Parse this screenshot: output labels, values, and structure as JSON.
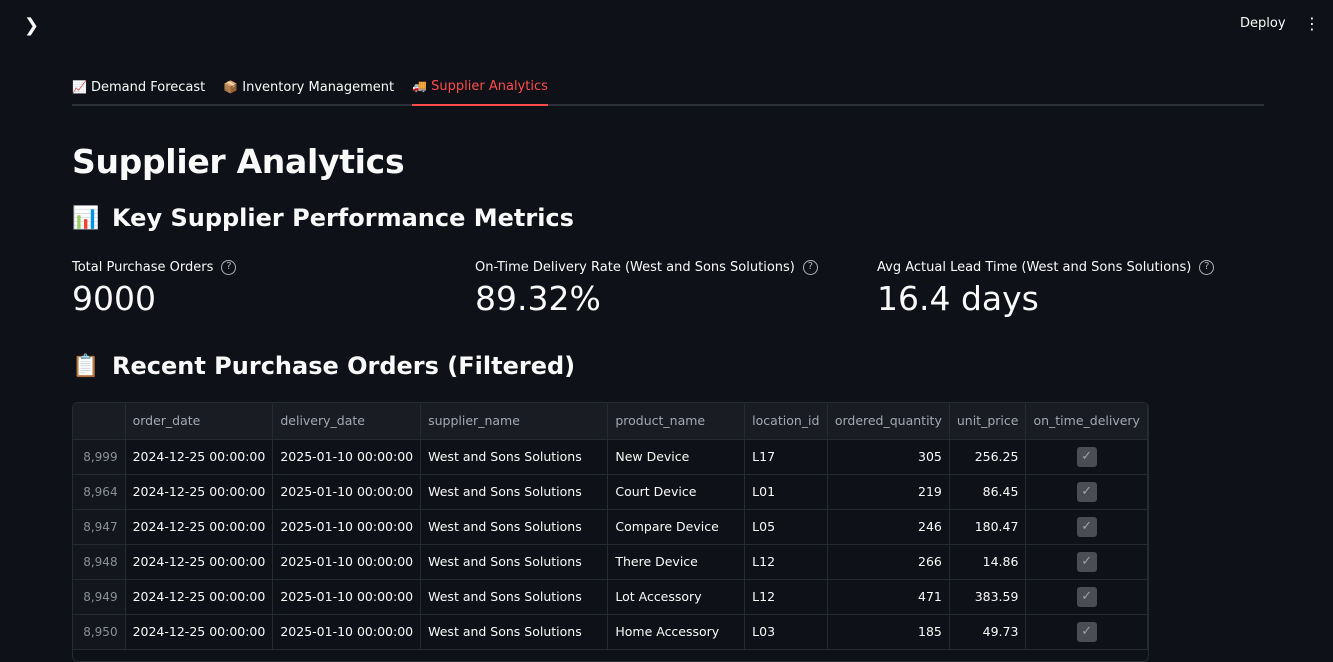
{
  "topbar": {
    "sidebar_toggle_icon": "chevron-right-icon",
    "deploy_label": "Deploy",
    "menu_icon": "vertical-dots-icon"
  },
  "tabs": [
    {
      "icon": "chart-increasing-emoji",
      "label": "Demand Forecast",
      "active": false
    },
    {
      "icon": "package-emoji",
      "label": "Inventory Management",
      "active": false
    },
    {
      "icon": "delivery-truck-emoji",
      "label": "Supplier Analytics",
      "active": true
    }
  ],
  "page_title": "Supplier Analytics",
  "metrics_section": {
    "icon": "bar-chart-emoji",
    "title": "Key Supplier Performance Metrics"
  },
  "metrics": [
    {
      "label": "Total Purchase Orders",
      "value": "9000"
    },
    {
      "label": "On-Time Delivery Rate (West and Sons Solutions)",
      "value": "89.32%"
    },
    {
      "label": "Avg Actual Lead Time (West and Sons Solutions)",
      "value": "16.4 days"
    }
  ],
  "orders_section": {
    "icon": "clipboard-emoji",
    "title": "Recent Purchase Orders (Filtered)"
  },
  "table": {
    "columns": [
      "",
      "order_date",
      "delivery_date",
      "supplier_name",
      "product_name",
      "location_id",
      "ordered_quantity",
      "unit_price",
      "on_time_delivery"
    ],
    "rows": [
      [
        "8,999",
        "2024-12-25 00:00:00",
        "2025-01-10 00:00:00",
        "West and Sons Solutions",
        "New Device",
        "L17",
        "305",
        "256.25",
        true
      ],
      [
        "8,964",
        "2024-12-25 00:00:00",
        "2025-01-10 00:00:00",
        "West and Sons Solutions",
        "Court Device",
        "L01",
        "219",
        "86.45",
        true
      ],
      [
        "8,947",
        "2024-12-25 00:00:00",
        "2025-01-10 00:00:00",
        "West and Sons Solutions",
        "Compare Device",
        "L05",
        "246",
        "180.47",
        true
      ],
      [
        "8,948",
        "2024-12-25 00:00:00",
        "2025-01-10 00:00:00",
        "West and Sons Solutions",
        "There Device",
        "L12",
        "266",
        "14.86",
        true
      ],
      [
        "8,949",
        "2024-12-25 00:00:00",
        "2025-01-10 00:00:00",
        "West and Sons Solutions",
        "Lot Accessory",
        "L12",
        "471",
        "383.59",
        true
      ],
      [
        "8,950",
        "2024-12-25 00:00:00",
        "2025-01-10 00:00:00",
        "West and Sons Solutions",
        "Home Accessory",
        "L03",
        "185",
        "49.73",
        true
      ]
    ]
  },
  "colors": {
    "background": "#0e1117",
    "accent": "#ff4b4b",
    "text": "#fafafa"
  }
}
